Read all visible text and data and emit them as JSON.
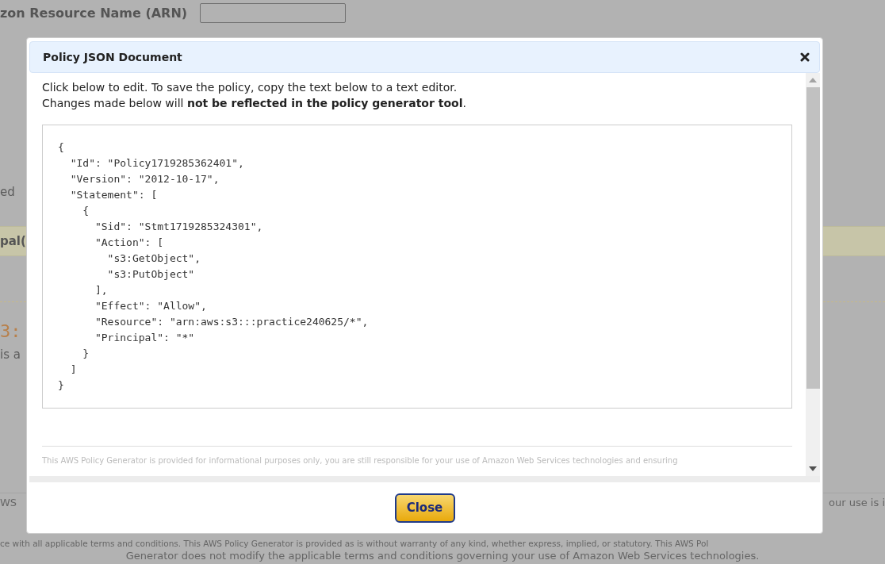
{
  "page": {
    "arn_label": "zon Resource Name (ARN)",
    "fragments": [
      {
        "kind": "text",
        "text": "ed"
      },
      {
        "kind": "band",
        "text": "pal("
      },
      {
        "kind": "heading",
        "text": "3:"
      },
      {
        "kind": "text",
        "text": "is a"
      }
    ],
    "footer": {
      "line_1_left": "WS",
      "line_1_right": "our use is i",
      "line_2": "ce with all applicable terms and conditions. This AWS Policy Generator is provided as is without warranty of any kind, whether express, implied, or statutory. This AWS Pol",
      "line_3": "Generator does not modify the applicable terms and conditions governing your use of Amazon Web Services technologies."
    }
  },
  "dialog": {
    "title": "Policy JSON Document",
    "intro": [
      "Click below to edit. To save the policy, copy the text below to a text editor.",
      "Changes made below will **not be reflected in the policy generator tool**."
    ],
    "policy_json": "{\n  \"Id\": \"Policy1719285362401\",\n  \"Version\": \"2012-10-17\",\n  \"Statement\": [\n    {\n      \"Sid\": \"Stmt1719285324301\",\n      \"Action\": [\n        \"s3:GetObject\",\n        \"s3:PutObject\"\n      ],\n      \"Effect\": \"Allow\",\n      \"Resource\": \"arn:aws:s3:::practice240625/*\",\n      \"Principal\": \"*\"\n    }\n  ]\n}",
    "disclaimer": "This AWS Policy Generator is provided for informational purposes only, you are still responsible for your use of Amazon Web Services technologies and ensuring",
    "close_button": "Close"
  }
}
